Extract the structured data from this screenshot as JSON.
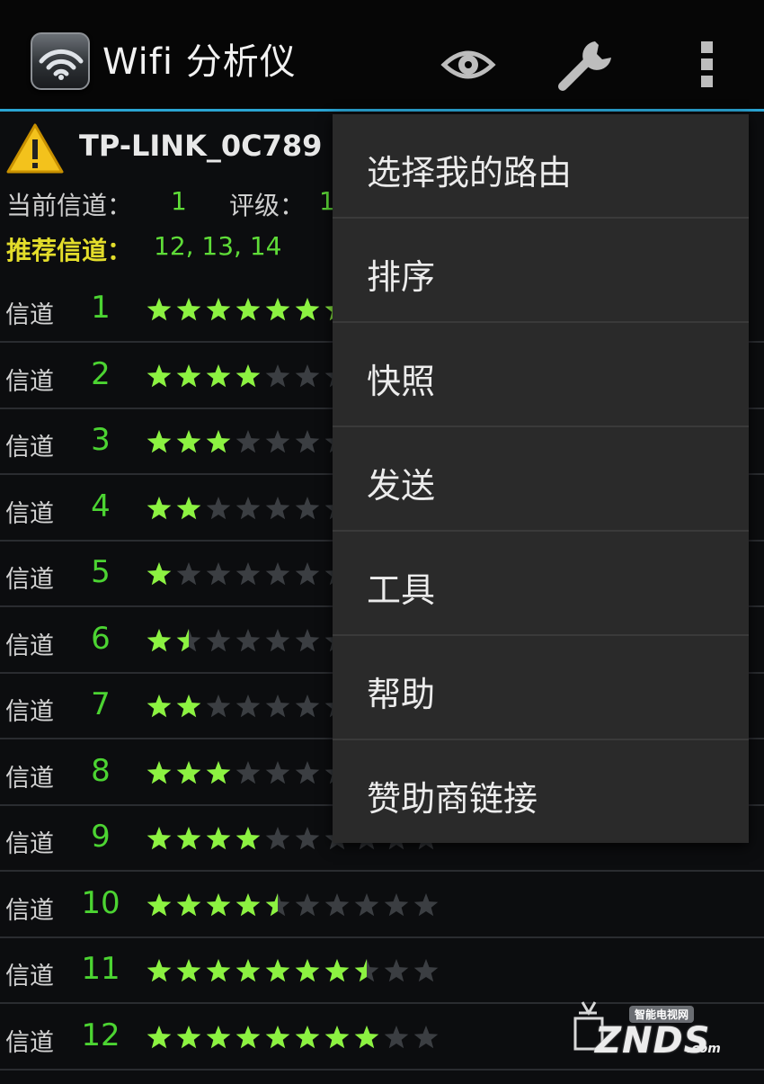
{
  "app": {
    "title": "Wifi 分析仪",
    "icons": {
      "app": "wifi-icon",
      "eye": "eye-icon",
      "tools": "wrench-icon",
      "overflow": "overflow-menu-icon"
    },
    "accent_color": "#2aa4d3"
  },
  "network": {
    "ssid": "TP-LINK_0C789 (2",
    "warning_icon": "warning-icon",
    "current_channel_label": "当前信道：",
    "current_channel": "1",
    "grade_label": "评级：",
    "grade_value": "1",
    "recommended_label": "推荐信道：",
    "recommended_channels": "12, 13, 14"
  },
  "channels": [
    {
      "label": "信道",
      "number": "1",
      "rating": 6.5
    },
    {
      "label": "信道",
      "number": "2",
      "rating": 4
    },
    {
      "label": "信道",
      "number": "3",
      "rating": 3
    },
    {
      "label": "信道",
      "number": "4",
      "rating": 2
    },
    {
      "label": "信道",
      "number": "5",
      "rating": 1
    },
    {
      "label": "信道",
      "number": "6",
      "rating": 1.5
    },
    {
      "label": "信道",
      "number": "7",
      "rating": 2
    },
    {
      "label": "信道",
      "number": "8",
      "rating": 3
    },
    {
      "label": "信道",
      "number": "9",
      "rating": 4
    },
    {
      "label": "信道",
      "number": "10",
      "rating": 4.5
    },
    {
      "label": "信道",
      "number": "11",
      "rating": 7.5
    },
    {
      "label": "信道",
      "number": "12",
      "rating": 8
    }
  ],
  "star_colors": {
    "filled": "#8cf241",
    "empty": "#3b3e42"
  },
  "max_stars": 10,
  "menu": {
    "items": [
      {
        "label": "选择我的路由"
      },
      {
        "label": "排序"
      },
      {
        "label": "快照"
      },
      {
        "label": "发送"
      },
      {
        "label": "工具"
      },
      {
        "label": "帮助"
      },
      {
        "label": "赞助商链接"
      }
    ]
  },
  "watermark": {
    "tag": "智能电视网",
    "text": "ZNDS",
    "domain": ".com"
  }
}
